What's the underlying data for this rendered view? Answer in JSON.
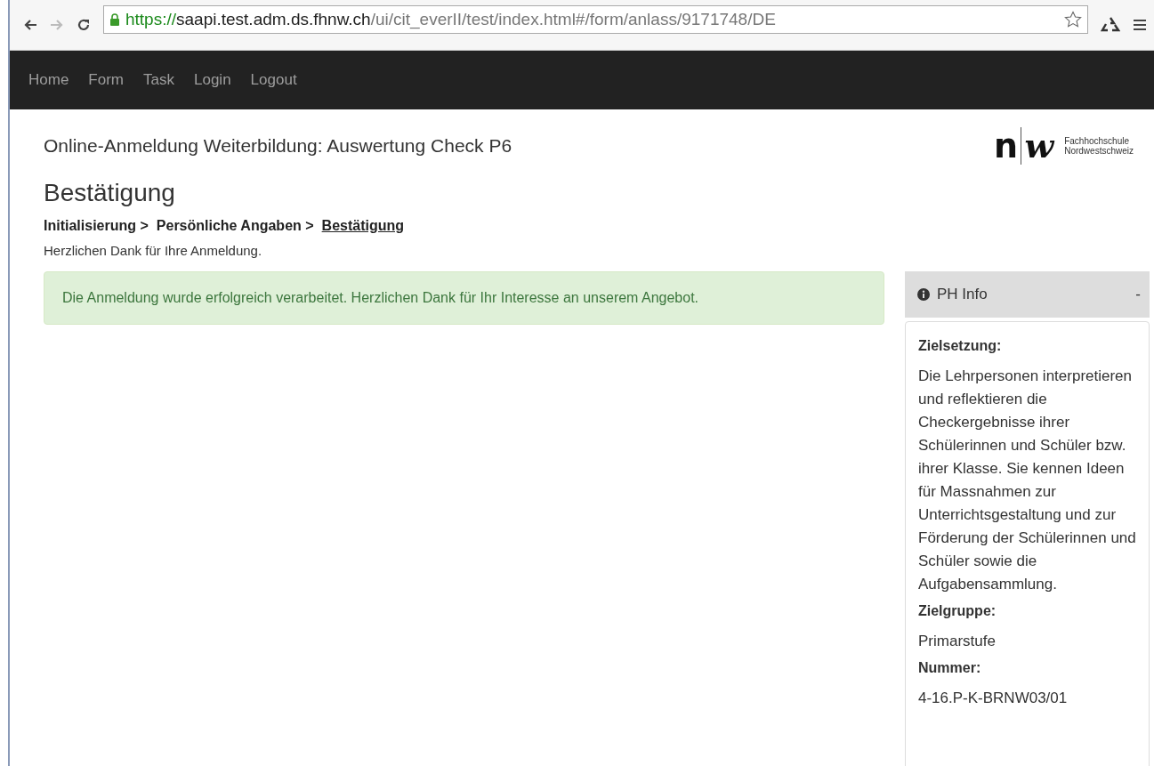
{
  "browser": {
    "url_scheme": "https://",
    "url_host": "saapi.test.adm.ds.fhnw.ch",
    "url_path": "/ui/cit_everII/test/index.html#/form/anlass/9171748/DE",
    "secure": true,
    "bookmarked": false
  },
  "nav": [
    {
      "label": "Home",
      "selected": false
    },
    {
      "label": "Form",
      "selected": false
    },
    {
      "label": "Task",
      "selected": false
    },
    {
      "label": "Login",
      "selected": false
    },
    {
      "label": "Logout",
      "selected": false
    }
  ],
  "header": {
    "title": "Online-Anmeldung Weiterbildung: Auswertung Check P6",
    "logo": {
      "letter_left": "n",
      "letter_right": "w",
      "line_1": "Fachhochschule",
      "line_2": "Nordwestschweiz"
    }
  },
  "page_title": "Bestätigung",
  "steps": [
    {
      "label": "Initialisierung >",
      "current": false
    },
    {
      "label": "Persönliche Angaben >",
      "current": false
    },
    {
      "label": "Bestätigung",
      "current": true
    }
  ],
  "intro": "Herzlichen Dank für Ihre Anmeldung.",
  "alert": {
    "kind": "success",
    "text": "Die Anmeldung wurde erfolgreich verarbeitet. Herzlichen Dank für Ihr Interesse an unserem Angebot."
  },
  "info_panel": {
    "title": "PH Info",
    "toggle": "-",
    "expanded": true,
    "fields": [
      {
        "label": "Zielsetzung:",
        "value": "Die Lehrpersonen interpretieren und reflektieren die Checkergebnisse ihrer Schülerinnen und Schüler bzw. ihrer Klasse. Sie kennen Ideen für Massnahmen zur Unterrichtsgestaltung und zur Förderung der Schülerinnen und Schüler sowie die Aufgabensammlung."
      },
      {
        "label": "Zielgruppe:",
        "value": "Primarstufe"
      },
      {
        "label": "Nummer:",
        "value": "4-16.P-K-BRNW03/01"
      }
    ]
  }
}
